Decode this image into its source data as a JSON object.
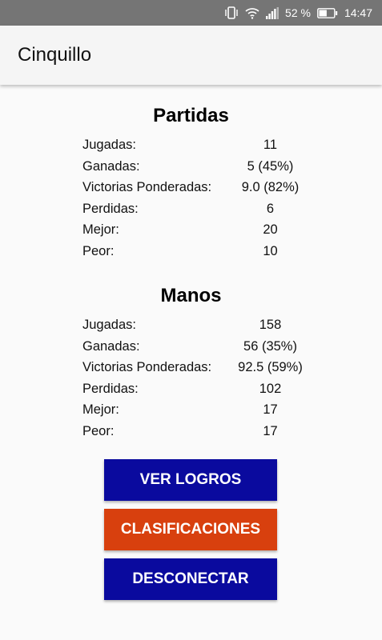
{
  "status_bar": {
    "battery_percent": "52 %",
    "time": "14:47",
    "icons": [
      "vibrate-icon",
      "wifi-icon",
      "signal-icon",
      "battery-icon"
    ]
  },
  "app_bar": {
    "title": "Cinquillo"
  },
  "partidas": {
    "title": "Partidas",
    "rows": [
      {
        "label": "Jugadas:",
        "value": "11"
      },
      {
        "label": "Ganadas:",
        "value": "5 (45%)"
      },
      {
        "label": "Victorias Ponderadas:",
        "value": "9.0 (82%)"
      },
      {
        "label": "Perdidas:",
        "value": "6"
      },
      {
        "label": "Mejor:",
        "value": "20"
      },
      {
        "label": "Peor:",
        "value": "10"
      }
    ]
  },
  "manos": {
    "title": "Manos",
    "rows": [
      {
        "label": "Jugadas:",
        "value": "158"
      },
      {
        "label": "Ganadas:",
        "value": "56 (35%)"
      },
      {
        "label": "Victorias Ponderadas:",
        "value": "92.5 (59%)"
      },
      {
        "label": "Perdidas:",
        "value": "102"
      },
      {
        "label": "Mejor:",
        "value": "17"
      },
      {
        "label": "Peor:",
        "value": "17"
      }
    ]
  },
  "buttons": {
    "achievements": {
      "label": "VER LOGROS",
      "color": "#0a0a9e"
    },
    "rankings": {
      "label": "CLASIFICACIONES",
      "color": "#d8400e"
    },
    "disconnect": {
      "label": "DESCONECTAR",
      "color": "#0a0a9e"
    }
  },
  "colors": {
    "status_bar_bg": "#757575",
    "app_bar_bg": "#f5f5f5",
    "page_bg": "#fafafa"
  }
}
